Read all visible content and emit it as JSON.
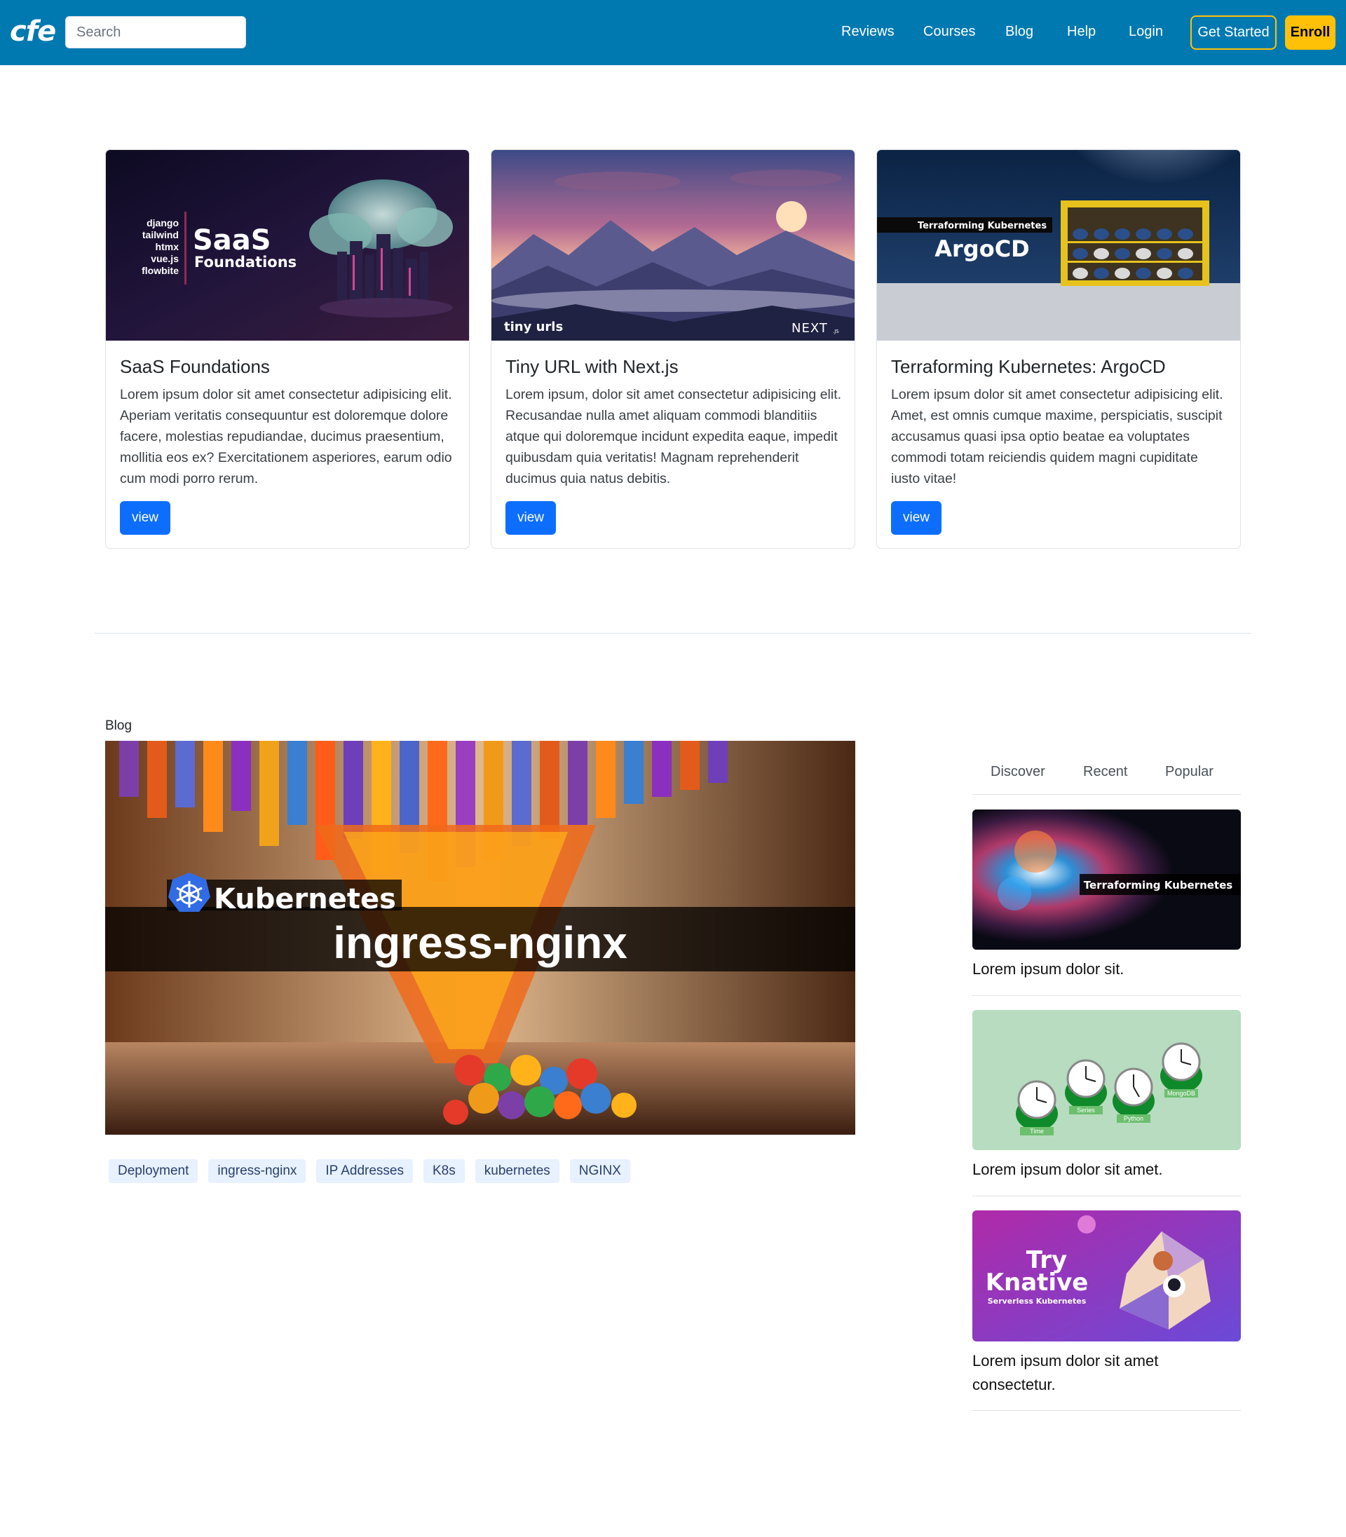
{
  "navbar": {
    "logo": "cfe",
    "search_placeholder": "Search",
    "links": [
      "Reviews",
      "Courses",
      "Blog",
      "Help",
      "Login"
    ],
    "get_started": "Get Started",
    "enroll": "Enroll"
  },
  "cards": [
    {
      "title": "SaaS Foundations",
      "text": "Lorem ipsum dolor sit amet consectetur adipisicing elit. Aperiam veritatis consequuntur est doloremque dolore facere, molestias repudiandae, ducimus praesentium, mollitia eos ex? Exercitationem asperiores, earum odio cum modi porro rerum.",
      "button": "view",
      "image_text": {
        "stack": [
          "django",
          "tailwind",
          "htmx",
          "vue.js",
          "flowbite"
        ],
        "headline": "SaaS",
        "subline": "Foundations"
      }
    },
    {
      "title": "Tiny URL with Next.js",
      "text": "Lorem ipsum, dolor sit amet consectetur adipisicing elit. Recusandae nulla amet aliquam commodi blanditiis atque qui doloremque incidunt expedita eaque, impedit quibusdam quia veritatis! Magnam reprehenderit ducimus quia natus debitis.",
      "button": "view",
      "image_text": {
        "caption": "tiny urls",
        "brand": "NEXT",
        "brand_suffix": ".JS"
      }
    },
    {
      "title": "Terraforming Kubernetes: ArgoCD",
      "text": "Lorem ipsum dolor sit amet consectetur adipisicing elit. Amet, est omnis cumque maxime, perspiciatis, suscipit accusamus quasi ipsa optio beatae ea voluptates commodi totam reiciendis quidem magni cupiditate iusto vitae!",
      "button": "view",
      "image_text": {
        "banner": "Terraforming Kubernetes",
        "headline": "ArgoCD"
      }
    }
  ],
  "blog": {
    "label": "Blog",
    "hero_text": {
      "badge": "Kubernetes",
      "headline": "ingress-nginx"
    },
    "tags": [
      "Deployment",
      "ingress-nginx",
      "IP Addresses",
      "K8s",
      "kubernetes",
      "NGINX"
    ]
  },
  "sidebar": {
    "tabs": [
      "Discover",
      "Recent",
      "Popular"
    ],
    "items": [
      {
        "title": "Lorem ipsum dolor sit.",
        "image_text": {
          "banner": "Terraforming Kubernetes"
        }
      },
      {
        "title": "Lorem ipsum dolor sit amet.",
        "image_text": {
          "labels": [
            "Time",
            "Series",
            "Python",
            "MongoDB"
          ]
        }
      },
      {
        "title": "Lorem ipsum dolor sit amet consectetur.",
        "image_text": {
          "line1": "Try",
          "line2": "Knative",
          "line3": "Serverless Kubernetes"
        }
      }
    ]
  },
  "colors": {
    "navbar": "#0079b0",
    "accent_yellow": "#ffc107",
    "primary_button": "#0d6efd",
    "tag_bg": "#e7f1ff"
  }
}
